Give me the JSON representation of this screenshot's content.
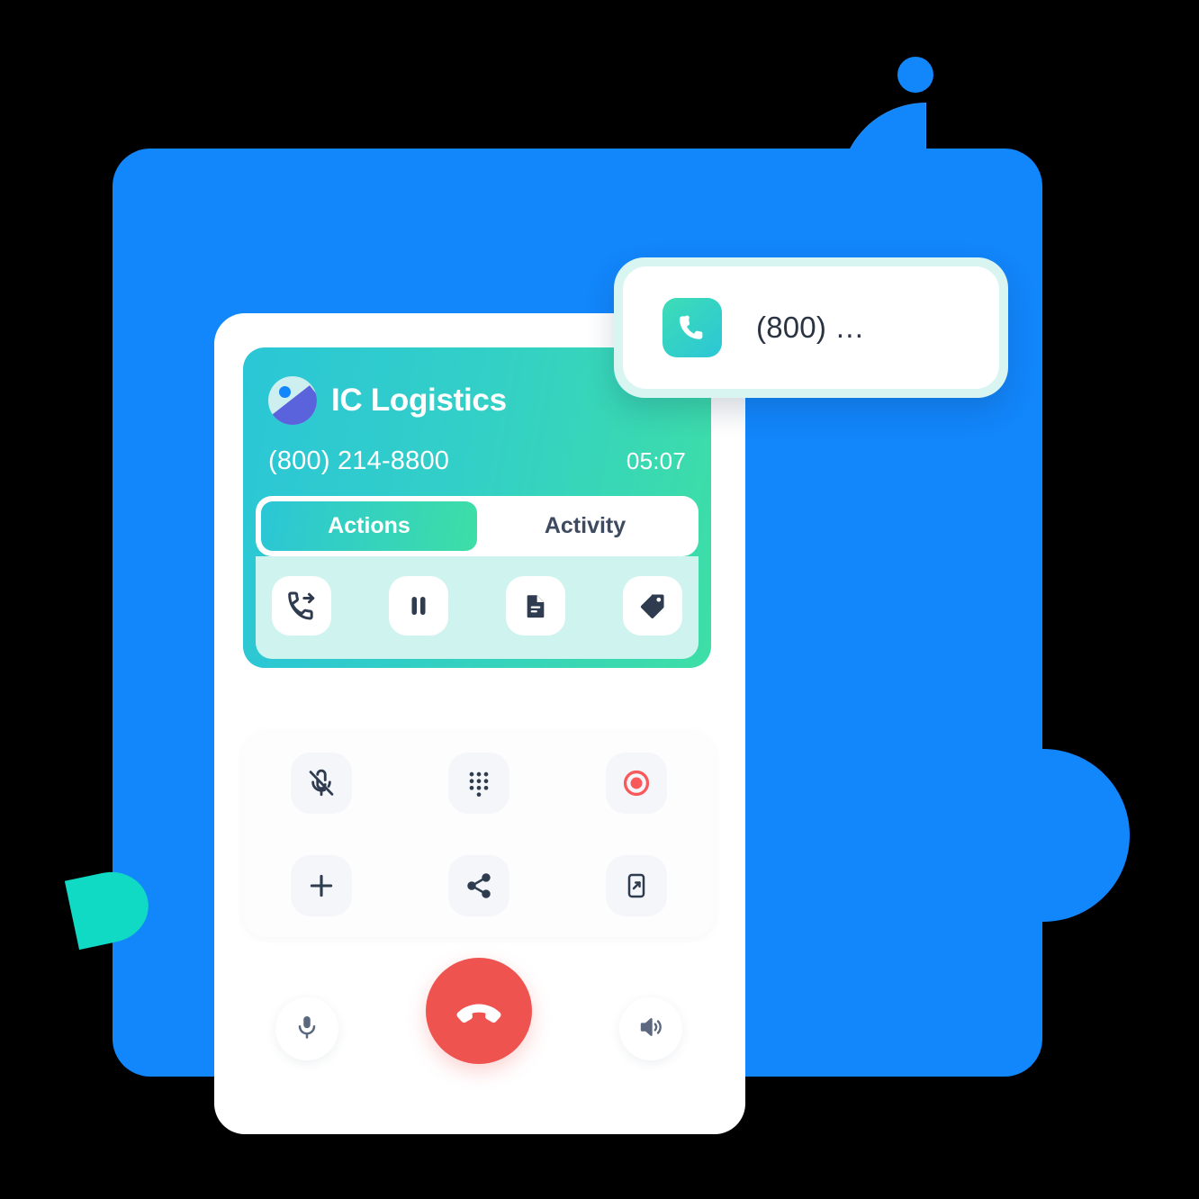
{
  "background": {
    "panel_color": "#1286FB",
    "accent_teal": "#10D9C4",
    "shapes": [
      {
        "name": "dot",
        "color": "#1286FB"
      },
      {
        "name": "quarter-circle",
        "color": "#1286FB"
      },
      {
        "name": "big-circle",
        "color": "#1286FB"
      },
      {
        "name": "teal-wedge",
        "color": "#10D9C4"
      }
    ]
  },
  "call": {
    "org_name": "IC Logistics",
    "phone_number": "(800) 214-8800",
    "timer": "05:07",
    "avatar_icon": "image-placeholder-icon",
    "header_gradient_from": "#2BC6D6",
    "header_gradient_to": "#3EDEA6",
    "tabs": [
      {
        "label": "Actions",
        "active": true
      },
      {
        "label": "Activity",
        "active": false
      }
    ],
    "actions": [
      {
        "name": "transfer-call-icon",
        "label": "Transfer call"
      },
      {
        "name": "pause-icon",
        "label": "Hold"
      },
      {
        "name": "notes-icon",
        "label": "Notes"
      },
      {
        "name": "tag-icon",
        "label": "Tag"
      }
    ],
    "controls": [
      {
        "name": "mic-off-icon",
        "label": "Mute"
      },
      {
        "name": "keypad-icon",
        "label": "Keypad"
      },
      {
        "name": "record-icon",
        "label": "Record",
        "color": "#F8595B"
      },
      {
        "name": "plus-icon",
        "label": "Add call"
      },
      {
        "name": "share-icon",
        "label": "Share"
      },
      {
        "name": "move-to-phone-icon",
        "label": "Move to phone"
      }
    ],
    "bottom": {
      "mic": {
        "name": "microphone-icon",
        "label": "Microphone"
      },
      "hangup": {
        "name": "hangup-icon",
        "label": "End call",
        "color": "#EF5350"
      },
      "speaker": {
        "name": "speaker-icon",
        "label": "Speaker"
      }
    }
  },
  "toast": {
    "icon": "phone-icon",
    "text": "(800) …",
    "icon_gradient_from": "#3DDDB6",
    "icon_gradient_to": "#2BC6D6"
  }
}
